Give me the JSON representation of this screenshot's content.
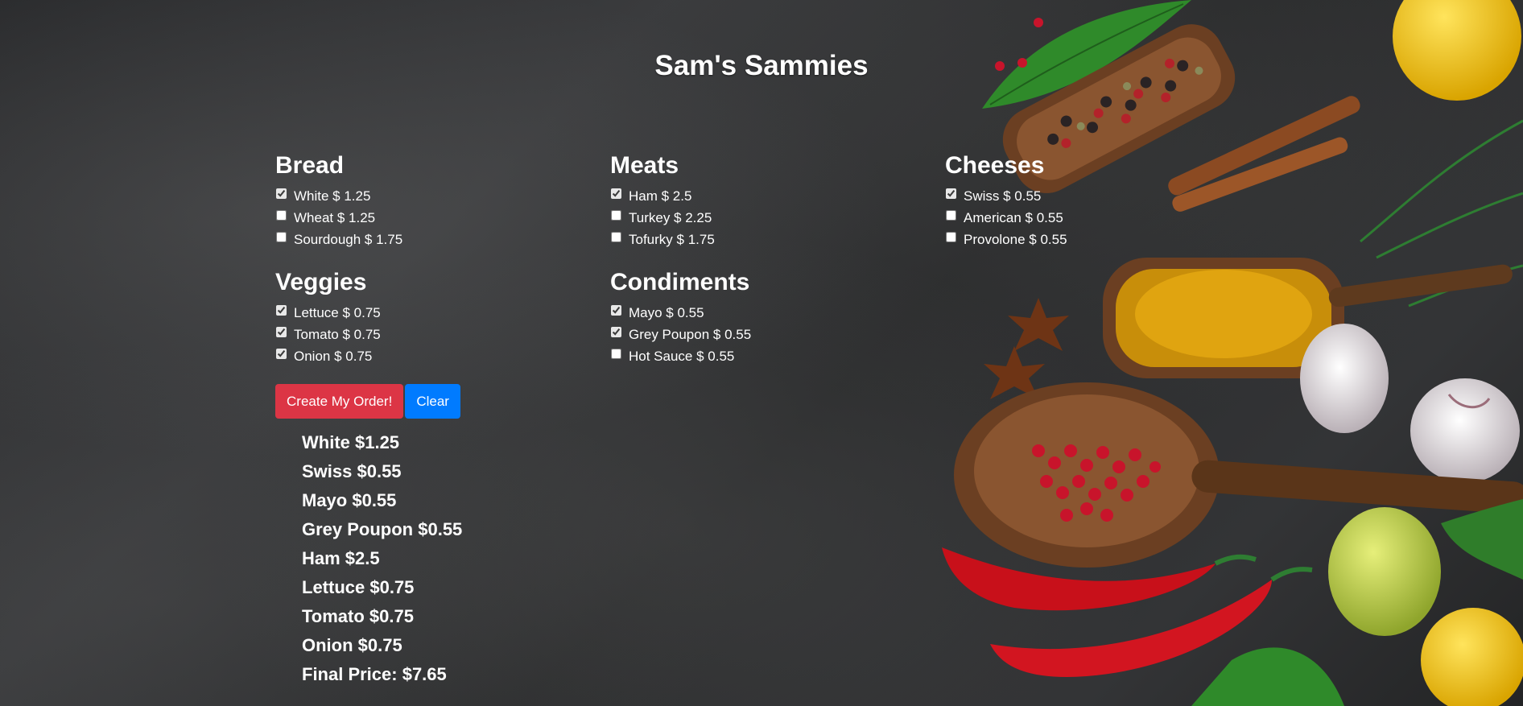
{
  "title": "Sam's Sammies",
  "sections": {
    "bread": {
      "heading": "Bread",
      "items": [
        {
          "label": "White $ 1.25",
          "checked": true
        },
        {
          "label": "Wheat $ 1.25",
          "checked": false
        },
        {
          "label": "Sourdough $ 1.75",
          "checked": false
        }
      ]
    },
    "meats": {
      "heading": "Meats",
      "items": [
        {
          "label": "Ham $ 2.5",
          "checked": true
        },
        {
          "label": "Turkey $ 2.25",
          "checked": false
        },
        {
          "label": "Tofurky $ 1.75",
          "checked": false
        }
      ]
    },
    "cheeses": {
      "heading": "Cheeses",
      "items": [
        {
          "label": "Swiss $ 0.55",
          "checked": true
        },
        {
          "label": "American $ 0.55",
          "checked": false
        },
        {
          "label": "Provolone $ 0.55",
          "checked": false
        }
      ]
    },
    "veggies": {
      "heading": "Veggies",
      "items": [
        {
          "label": "Lettuce $ 0.75",
          "checked": true
        },
        {
          "label": "Tomato $ 0.75",
          "checked": true
        },
        {
          "label": "Onion $ 0.75",
          "checked": true
        }
      ]
    },
    "condiments": {
      "heading": "Condiments",
      "items": [
        {
          "label": "Mayo $ 0.55",
          "checked": true
        },
        {
          "label": "Grey Poupon $ 0.55",
          "checked": true
        },
        {
          "label": "Hot Sauce $ 0.55",
          "checked": false
        }
      ]
    }
  },
  "buttons": {
    "create_label": "Create My Order!",
    "clear_label": "Clear",
    "create_color": "#dc3545",
    "clear_color": "#007bff"
  },
  "order": {
    "lines": [
      "White $1.25",
      "Swiss $0.55",
      "Mayo $0.55",
      "Grey Poupon $0.55",
      "Ham $2.5",
      "Lettuce $0.75",
      "Tomato $0.75",
      "Onion $0.75"
    ],
    "final_price": "Final Price: $7.65"
  }
}
